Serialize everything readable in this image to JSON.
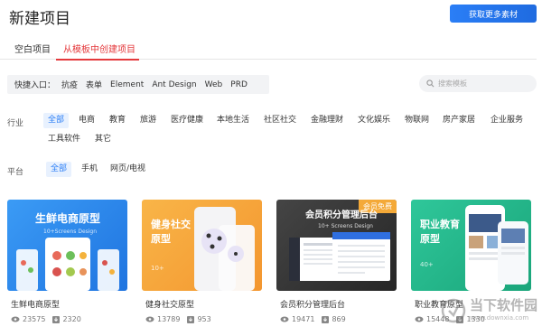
{
  "header": {
    "title": "新建项目",
    "action_label": "获取更多素材"
  },
  "tabs": [
    {
      "label": "空白项目"
    },
    {
      "label": "从模板中创建项目"
    }
  ],
  "quick_entry": {
    "label": "快捷入口：",
    "items": [
      "抗疫",
      "表单",
      "Element",
      "Ant Design",
      "Web",
      "PRD"
    ]
  },
  "search": {
    "placeholder": "搜索模板"
  },
  "industry": {
    "label": "行业",
    "items": [
      "全部",
      "电商",
      "教育",
      "旅游",
      "医疗健康",
      "本地生活",
      "社区社交",
      "金融理财",
      "文化娱乐",
      "物联网",
      "房产家居",
      "企业服务",
      "工具软件",
      "其它"
    ]
  },
  "platform": {
    "label": "平台",
    "items": [
      "全部",
      "手机",
      "网页/电视"
    ]
  },
  "cards": [
    {
      "name": "生鲜电商原型",
      "thumb_title": "生鲜电商原型",
      "thumb_sub": "10+Screens Design",
      "views": "23575",
      "likes": "2320",
      "bg": "#2f8ef1"
    },
    {
      "name": "健身社交原型",
      "thumb_title": "健身社交\n原型",
      "thumb_sub": "10+",
      "views": "13789",
      "likes": "953",
      "bg": "#f6a73b"
    },
    {
      "name": "会员积分管理后台",
      "thumb_title": "会员积分管理后台",
      "thumb_sub": "10+ Screens Design",
      "views": "19471",
      "likes": "869",
      "badge": "会员免费",
      "bg": "#3a3a3a"
    },
    {
      "name": "职业教育原型",
      "thumb_title": "职业教育\n原型",
      "thumb_sub": "40+",
      "views": "15448",
      "likes": "1330",
      "bg": "#25b98a"
    }
  ],
  "watermark": {
    "text": "当下软件园",
    "url": "www.downxia.com"
  },
  "colors": {
    "accent": "#2a7ef6",
    "active_tab": "#e4393c"
  }
}
